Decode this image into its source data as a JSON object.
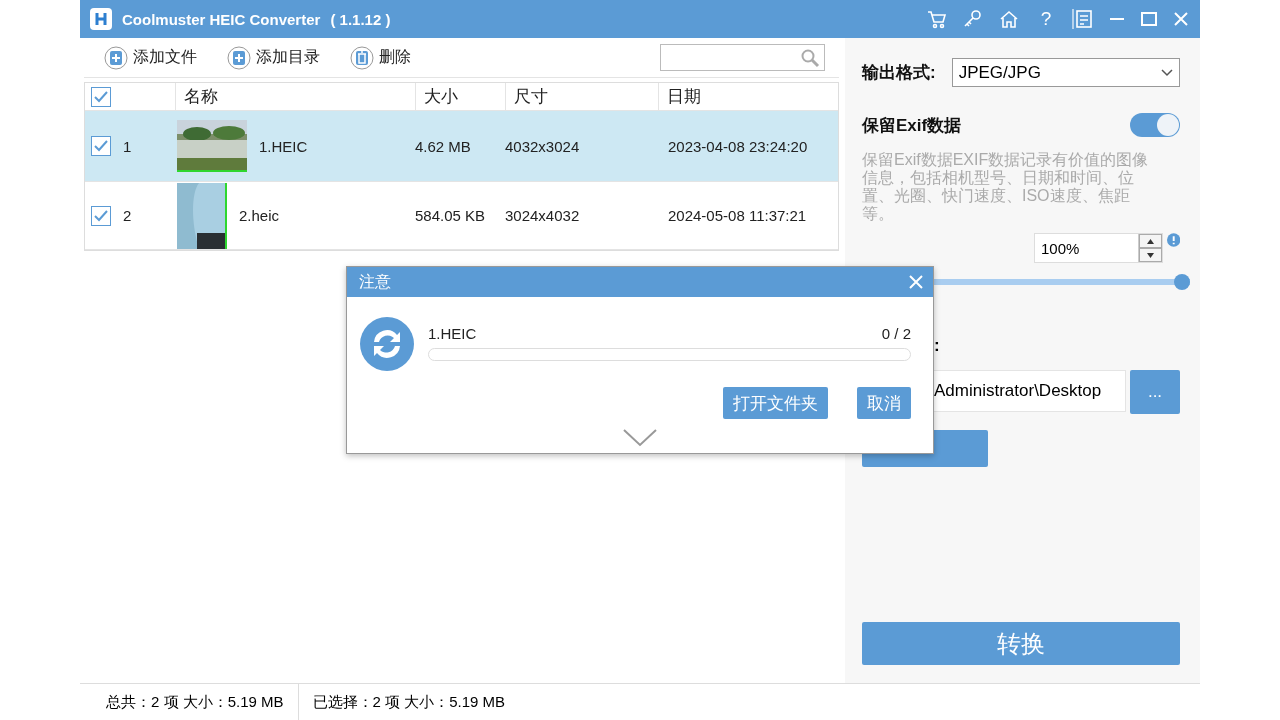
{
  "window": {
    "title": "Coolmuster HEIC Converter",
    "version": "( 1.1.12 )",
    "controls": [
      "?"
    ]
  },
  "toolbar": {
    "buttons": [
      {
        "kind": "add-file",
        "label": "添加文件"
      },
      {
        "kind": "add-folder",
        "label": "添加目录"
      },
      {
        "kind": "delete",
        "label": "删除"
      }
    ]
  },
  "table": {
    "all_checked": true,
    "columns": [
      "名称",
      "大小",
      "尺寸",
      "日期"
    ],
    "rows": [
      {
        "checked": true,
        "selected": true,
        "index": "1",
        "name": "1.HEIC",
        "size": "4.62 MB",
        "dimensions": "4032x3024",
        "date": "2023-04-08 23:24:20"
      },
      {
        "checked": true,
        "selected": false,
        "index": "2",
        "name": "2.heic",
        "size": "584.05 KB",
        "dimensions": "3024x4032",
        "date": "2024-05-08 11:37:21"
      }
    ]
  },
  "settings": {
    "format_label": "输出格式:",
    "format_value": "JPEG/JPG",
    "exif_label": "保留Exif数据",
    "exif_on": true,
    "exif_description": "保留Exif数据EXIF数据记录有价值的图像信息，包括相机型号、日期和时间、位置、光圈、快门速度、ISO速度、焦距等。",
    "quality_value": "100%",
    "quality_slider": {
      "level": 1
    },
    "output_label": ":",
    "output_path": "Administrator\\Desktop",
    "browse_button": "...",
    "convert_button": "转换"
  },
  "status_bar": [
    "总共：2 项 大小：5.19 MB",
    "已选择：2 项 大小：5.19 MB"
  ],
  "dialog": {
    "title": "注意",
    "file": "1.HEIC",
    "count": "0 / 2",
    "progress": {
      "level": 0
    },
    "buttons": [
      "打开文件夹",
      "取消"
    ]
  }
}
